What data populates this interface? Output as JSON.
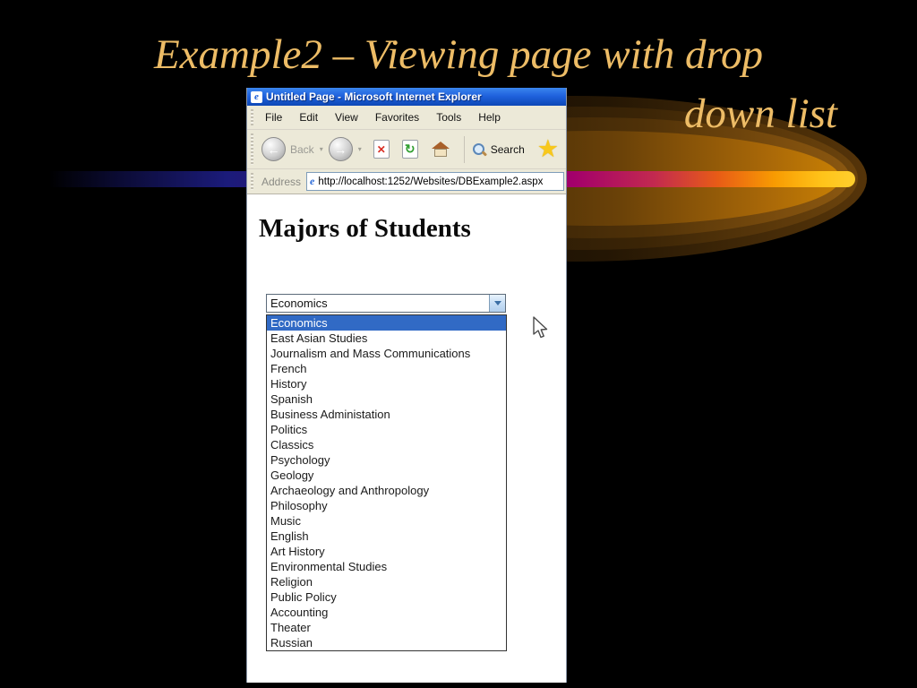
{
  "slide": {
    "title_line1": "Example2 – Viewing page with drop",
    "title_line2": "down list",
    "colors": {
      "title": "#EDBC66",
      "background": "#000000",
      "stripe_magenta": "#A3006B",
      "stripe_gold": "#FFC41A"
    }
  },
  "browser": {
    "window_title": "Untitled Page - Microsoft Internet Explorer",
    "menu_items": [
      "File",
      "Edit",
      "View",
      "Favorites",
      "Tools",
      "Help"
    ],
    "toolbar": {
      "back_label": "Back",
      "search_label": "Search"
    },
    "address": {
      "label": "Address",
      "url": "http://localhost:1252/Websites/DBExample2.aspx"
    }
  },
  "page": {
    "heading": "Majors of Students",
    "dropdown": {
      "selected": "Economics",
      "highlight_color": "#316AC5",
      "options": [
        "Economics",
        "East Asian Studies",
        "Journalism and Mass Communications",
        "French",
        "History",
        "Spanish",
        "Business Administation",
        "Politics",
        "Classics",
        "Psychology",
        "Geology",
        "Archaeology and Anthropology",
        "Philosophy",
        "Music",
        "English",
        "Art History",
        "Environmental Studies",
        "Religion",
        "Public Policy",
        "Accounting",
        "Theater",
        "Russian"
      ]
    }
  }
}
